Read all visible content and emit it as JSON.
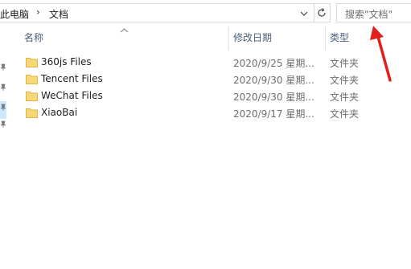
{
  "address": {
    "crumbs": [
      "此电脑",
      "文档"
    ],
    "separator": "›"
  },
  "search": {
    "placeholder": "搜索\"文档\""
  },
  "columns": {
    "name": "名称",
    "date": "修改日期",
    "type": "类型"
  },
  "files": [
    {
      "name": "360js Files",
      "date": "2020/9/25 星期...",
      "type": "文件夹"
    },
    {
      "name": "Tencent Files",
      "date": "2020/9/30 星期...",
      "type": "文件夹"
    },
    {
      "name": "WeChat Files",
      "date": "2020/9/30 星期...",
      "type": "文件夹"
    },
    {
      "name": "XiaoBai",
      "date": "2020/9/17 星期...",
      "type": "文件夹"
    }
  ],
  "colors": {
    "folder": "#f8d775",
    "folder_dark": "#e0b547",
    "annotation_arrow": "#e0201c",
    "selection": "#cce8ff"
  },
  "icons": [
    "chevron-down-icon",
    "refresh-icon",
    "sort-up-icon",
    "pin-icon",
    "folder-icon"
  ]
}
